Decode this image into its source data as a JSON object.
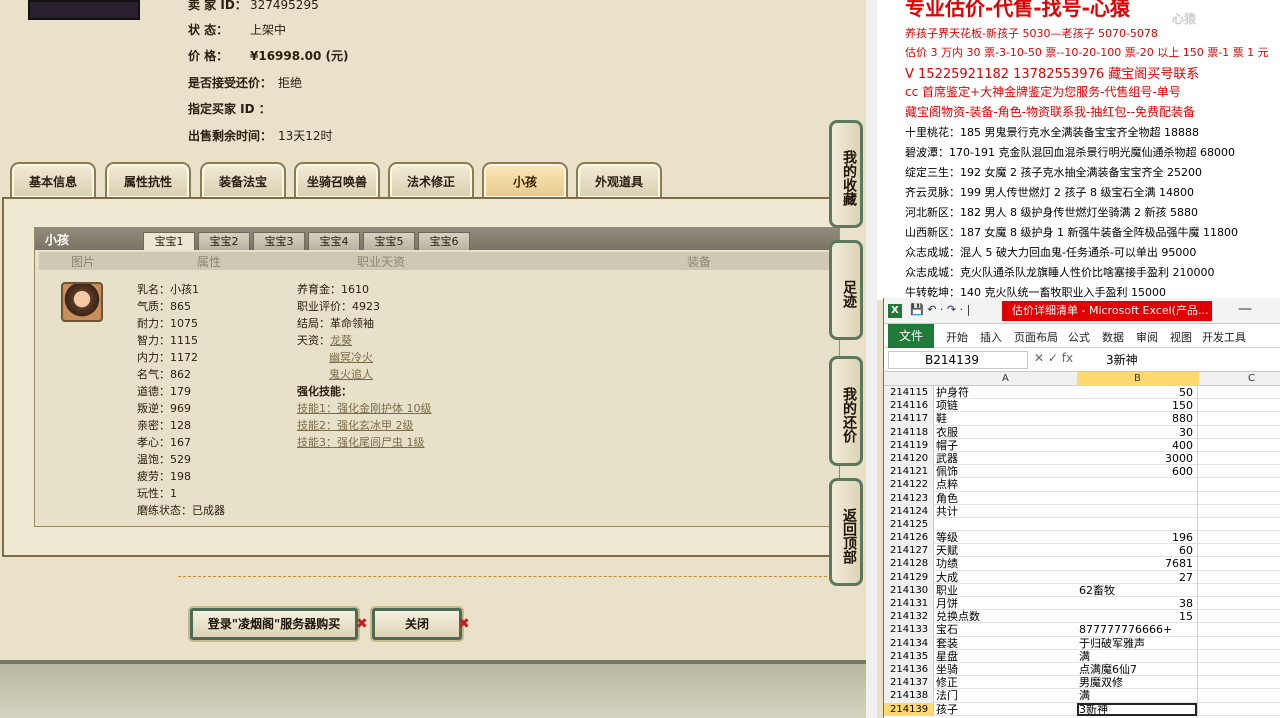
{
  "left": {
    "info": [
      {
        "label": "卖 家 ID：",
        "value": "327495295"
      },
      {
        "label": "状 态：",
        "value": "上架中"
      },
      {
        "label": "价 格：",
        "value": "¥16998.00 (元)"
      },
      {
        "label": "是否接受还价：",
        "value": "拒绝"
      },
      {
        "label": "指定买家 ID ：",
        "value": ""
      },
      {
        "label": "出售剩余时间：",
        "value": "13天12时"
      }
    ],
    "tabs": [
      "基本信息",
      "属性抗性",
      "装备法宝",
      "坐骑召唤兽",
      "法术修正",
      "小孩",
      "外观道具"
    ],
    "panel": {
      "title": "小孩",
      "baby_tabs": [
        "宝宝1",
        "宝宝2",
        "宝宝3",
        "宝宝4",
        "宝宝5",
        "宝宝6"
      ],
      "columns": [
        "图片",
        "属性",
        "职业天资",
        "装备"
      ],
      "attrs": [
        "乳名：小孩1",
        "气质：865",
        "耐力：1075",
        "智力：1115",
        "内力：1172",
        "名气：862",
        "道德：179",
        "叛逆：969",
        "亲密：128",
        "孝心：167",
        "温饱：529",
        "疲劳：198",
        "玩性：1",
        "磨练状态：已成器"
      ],
      "career": {
        "yangyu": "养育金：1610",
        "pingjia": "职业评价：4923",
        "jieju": "结局：革命领袖",
        "tianzi_label": "天资：",
        "tianzi": [
          "龙葵",
          "幽冥冷火",
          "鬼火追人"
        ],
        "skills_label": "强化技能：",
        "skills": [
          "技能1：强化金刚护体 10级",
          "技能2：强化玄冰甲 2级",
          "技能3：强化尾闾尸虫 1级"
        ]
      }
    },
    "buttons": {
      "buy": "登录\"凌烟阁\"服务器购买",
      "close": "关闭"
    },
    "sidebar": [
      "我的收藏",
      "足迹",
      "我的还价",
      "返回顶部"
    ]
  },
  "right": {
    "title": "专业估价-代售-找号-心猿",
    "logo": "心猿",
    "lines": [
      {
        "text": "养孩子界天花板-新孩子 5030—老孩子 5070-5078",
        "red": true
      },
      {
        "text": "估价 3 万内 30 票-3-10-50 票--10-20-100 票-20 以上 150 票-1 票 1 元",
        "red": true
      },
      {
        "text": "V 15225921182    13782553976   藏宝阁买号联系",
        "red": true
      },
      {
        "text": "cc 首席鉴定+大神金牌鉴定为您服务-代售组号-单号",
        "red": true
      },
      {
        "text": "藏宝阁物资-装备-角色-物资联系我-抽红包--免费配装备",
        "red": true
      },
      {
        "text": "十里桃花：185 男鬼景行克水全满装备宝宝齐全物超 18888",
        "red": false
      },
      {
        "text": "碧波潭：170-191 克金队混回血混杀景行明光魔仙通杀物超 68000",
        "red": false
      },
      {
        "text": "绽定三生：192 女魔 2 孩子克水抽全满装备宝宝齐全 25200",
        "red": false
      },
      {
        "text": "齐云灵脉：199 男人传世燃灯 2 孩子 8 级宝石全满 14800",
        "red": false
      },
      {
        "text": "河北新区：182 男人 8 级护身传世燃灯坐骑满 2 新孩 5880",
        "red": false
      },
      {
        "text": "山西新区：187 女魔 8 级护身 1 新强牛装备全阵极品强牛魔 11800",
        "red": false
      },
      {
        "text": "众志成城：混人 5 破大力回血鬼-任务通杀-可以单出 95000",
        "red": false
      },
      {
        "text": "众志成城：克火队通杀队龙旗睡人性价比啥塞接手盈利 210000",
        "red": false
      },
      {
        "text": "牛转乾坤：140 克火队统一畜牧职业入手盈利 15000",
        "red": false
      }
    ]
  },
  "excel": {
    "title": "估价详细清单 - Microsoft Excel(产品...",
    "ribbon": [
      "文件",
      "开始",
      "插入",
      "页面布局",
      "公式",
      "数据",
      "审阅",
      "视图",
      "开发工具"
    ],
    "namebox": "B214139",
    "formula": "3新神",
    "col_headers": [
      "A",
      "B",
      "C"
    ],
    "rows": [
      {
        "n": "214115",
        "a": "护身符",
        "b": "50",
        "num": true
      },
      {
        "n": "214116",
        "a": "项链",
        "b": "150",
        "num": true
      },
      {
        "n": "214117",
        "a": "鞋",
        "b": "880",
        "num": true
      },
      {
        "n": "214118",
        "a": "衣服",
        "b": "30",
        "num": true
      },
      {
        "n": "214119",
        "a": "帽子",
        "b": "400",
        "num": true
      },
      {
        "n": "214120",
        "a": "武器",
        "b": "3000",
        "num": true
      },
      {
        "n": "214121",
        "a": "佩饰",
        "b": "600",
        "num": true
      },
      {
        "n": "214122",
        "a": "点粹",
        "b": "",
        "num": true
      },
      {
        "n": "214123",
        "a": "角色",
        "b": "",
        "num": true
      },
      {
        "n": "214124",
        "a": "共计",
        "b": "",
        "num": true
      },
      {
        "n": "214125",
        "a": "",
        "b": "",
        "num": true
      },
      {
        "n": "214126",
        "a": "等级",
        "b": "196",
        "num": true
      },
      {
        "n": "214127",
        "a": "天赋",
        "b": "60",
        "num": true
      },
      {
        "n": "214128",
        "a": "功绩",
        "b": "7681",
        "num": true
      },
      {
        "n": "214129",
        "a": "大成",
        "b": "27",
        "num": true
      },
      {
        "n": "214130",
        "a": "职业",
        "b": "62畜牧",
        "num": false
      },
      {
        "n": "214131",
        "a": "月饼",
        "b": "38",
        "num": true
      },
      {
        "n": "214132",
        "a": "兑换点数",
        "b": "15",
        "num": true
      },
      {
        "n": "214133",
        "a": "宝石",
        "b": "877777776666+",
        "num": false
      },
      {
        "n": "214134",
        "a": "套装",
        "b": "于归破军雅声",
        "num": false
      },
      {
        "n": "214135",
        "a": "星盘",
        "b": "满",
        "num": false
      },
      {
        "n": "214136",
        "a": "坐骑",
        "b": "点满魔6仙7",
        "num": false
      },
      {
        "n": "214137",
        "a": "修正",
        "b": "男魔双修",
        "num": false
      },
      {
        "n": "214138",
        "a": "法门",
        "b": "满",
        "num": false
      },
      {
        "n": "214139",
        "a": "孩子",
        "b": "3新神",
        "num": false,
        "sel": true
      }
    ]
  }
}
